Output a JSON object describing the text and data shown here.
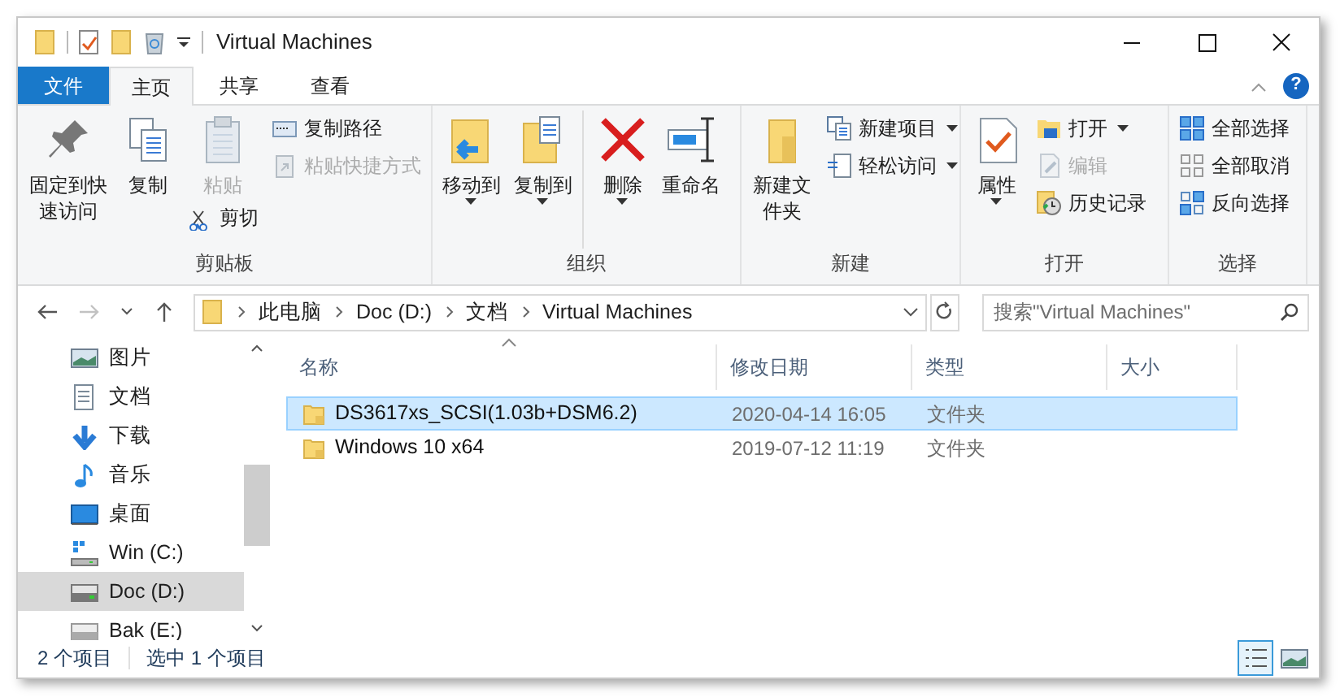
{
  "window": {
    "title": "Virtual Machines"
  },
  "ribbon_tabs": [
    {
      "label": "文件",
      "kind": "file",
      "selected": false
    },
    {
      "label": "主页",
      "kind": "tab",
      "selected": true
    },
    {
      "label": "共享",
      "kind": "tab",
      "selected": false
    },
    {
      "label": "查看",
      "kind": "tab",
      "selected": false
    }
  ],
  "ribbon_groups": [
    {
      "label": "剪贴板",
      "columns": [
        [
          {
            "label": "固定到快速访问",
            "kind": "large",
            "disabled": false,
            "dropdown": false
          }
        ],
        [
          {
            "label": "复制",
            "kind": "large",
            "disabled": false,
            "dropdown": false
          }
        ],
        [
          {
            "label": "粘贴",
            "kind": "large",
            "disabled": true,
            "dropdown": false
          },
          {
            "label": "剪切",
            "kind": "small",
            "disabled": false,
            "dropdown": false
          }
        ],
        [
          {
            "label": "复制路径",
            "kind": "small",
            "disabled": false,
            "dropdown": false
          },
          {
            "label": "粘贴快捷方式",
            "kind": "small",
            "disabled": true,
            "dropdown": false
          }
        ]
      ]
    },
    {
      "label": "组织",
      "columns": [
        [
          {
            "label": "移动到",
            "kind": "large",
            "disabled": false,
            "dropdown": true
          }
        ],
        [
          {
            "label": "复制到",
            "kind": "large",
            "disabled": false,
            "dropdown": true
          }
        ],
        [
          {
            "label": "删除",
            "kind": "large",
            "disabled": false,
            "dropdown": true
          }
        ],
        [
          {
            "label": "重命名",
            "kind": "large",
            "disabled": false,
            "dropdown": false
          }
        ]
      ]
    },
    {
      "label": "新建",
      "columns": [
        [
          {
            "label": "新建文件夹",
            "kind": "large",
            "disabled": false,
            "dropdown": false
          }
        ],
        [
          {
            "label": "新建项目",
            "kind": "small",
            "disabled": false,
            "dropdown": true
          },
          {
            "label": "轻松访问",
            "kind": "small",
            "disabled": false,
            "dropdown": true
          }
        ]
      ]
    },
    {
      "label": "打开",
      "columns": [
        [
          {
            "label": "属性",
            "kind": "large",
            "disabled": false,
            "dropdown": true
          }
        ],
        [
          {
            "label": "打开",
            "kind": "small",
            "disabled": false,
            "dropdown": true
          },
          {
            "label": "编辑",
            "kind": "small",
            "disabled": true,
            "dropdown": false
          },
          {
            "label": "历史记录",
            "kind": "small",
            "disabled": false,
            "dropdown": false
          }
        ]
      ]
    },
    {
      "label": "选择",
      "columns": [
        [
          {
            "label": "全部选择",
            "kind": "small",
            "disabled": false,
            "dropdown": false
          },
          {
            "label": "全部取消",
            "kind": "small",
            "disabled": false,
            "dropdown": false
          },
          {
            "label": "反向选择",
            "kind": "small",
            "disabled": false,
            "dropdown": false
          }
        ]
      ]
    }
  ],
  "address": {
    "crumbs": [
      "此电脑",
      "Doc (D:)",
      "文档",
      "Virtual Machines"
    ],
    "search_placeholder": "搜索\"Virtual Machines\""
  },
  "nav_buttons": [
    {
      "disabled": false
    },
    {
      "disabled": true
    },
    {
      "disabled": false
    },
    {
      "disabled": false
    }
  ],
  "sidebar": {
    "items": [
      {
        "label": "图片",
        "selected": false
      },
      {
        "label": "文档",
        "selected": false
      },
      {
        "label": "下载",
        "selected": false
      },
      {
        "label": "音乐",
        "selected": false
      },
      {
        "label": "桌面",
        "selected": false
      },
      {
        "label": "Win (C:)",
        "selected": false
      },
      {
        "label": "Doc (D:)",
        "selected": true
      },
      {
        "label": "Bak (E:)",
        "selected": false
      }
    ]
  },
  "table": {
    "columns": [
      "名称",
      "修改日期",
      "类型",
      "大小"
    ],
    "rows": [
      {
        "cells": [
          "DS3617xs_SCSI(1.03b+DSM6.2)",
          "2020-04-14 16:05",
          "文件夹"
        ],
        "selected": true
      },
      {
        "cells": [
          "Windows 10 x64",
          "2019-07-12 11:19",
          "文件夹"
        ],
        "selected": false
      }
    ]
  },
  "status_bar": {
    "items": [
      "2 个项目",
      "选中 1 个项目"
    ]
  },
  "view_buttons": [
    {
      "selected": true
    },
    {
      "selected": false
    }
  ],
  "help_label": "?"
}
